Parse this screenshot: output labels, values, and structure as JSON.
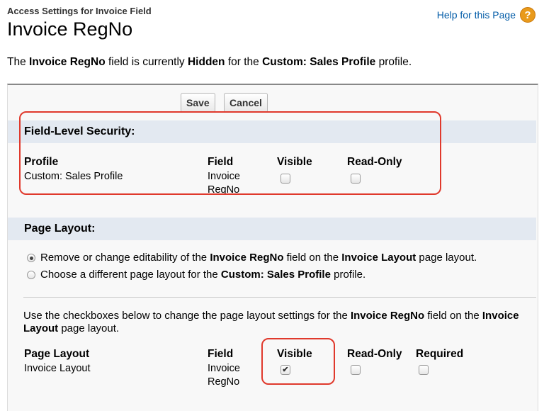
{
  "header": {
    "breadcrumb": "Access Settings for Invoice Field",
    "title": "Invoice RegNo",
    "help_link": "Help for this Page",
    "help_icon": "?"
  },
  "description": {
    "p1": "The ",
    "field": "Invoice RegNo",
    "p2": " field is currently ",
    "state": "Hidden",
    "p3": " for the ",
    "profile": "Custom: Sales Profile",
    "p4": " profile."
  },
  "toolbar": {
    "save_label": "Save",
    "cancel_label": "Cancel"
  },
  "fls": {
    "header": "Field-Level Security:",
    "columns": {
      "profile": "Profile",
      "field": "Field",
      "visible": "Visible",
      "read_only": "Read-Only"
    },
    "row": {
      "profile": "Custom: Sales Profile",
      "field_line1": "Invoice",
      "field_line2": "RegNo",
      "visible": false,
      "read_only": false
    }
  },
  "layout": {
    "header": "Page Layout:",
    "options": [
      {
        "t1": "Remove or change editability of the ",
        "b1": "Invoice RegNo",
        "t2": " field on the ",
        "b2": "Invoice Layout",
        "t3": " page layout.",
        "selected": true
      },
      {
        "t1": "Choose a different page layout for the ",
        "b1": "Custom: Sales Profile",
        "t2": " profile.",
        "selected": false
      }
    ],
    "instructions": {
      "t1": "Use the checkboxes below to change the page layout settings for the ",
      "b1": "Invoice RegNo",
      "t2": " field on the ",
      "b2": "Invoice Layout",
      "t3": " page layout."
    },
    "columns": {
      "layout": "Page Layout",
      "field": "Field",
      "visible": "Visible",
      "read_only": "Read-Only",
      "required": "Required"
    },
    "row": {
      "layout": "Invoice Layout",
      "field_line1": "Invoice",
      "field_line2": "RegNo",
      "visible": true,
      "read_only": false,
      "required": false,
      "check_glyph": "✔"
    }
  },
  "colors": {
    "highlight": "#e0392c",
    "link": "#015ba7",
    "section_bg": "#e3e9f1",
    "help_icon": "#e99a1b"
  }
}
